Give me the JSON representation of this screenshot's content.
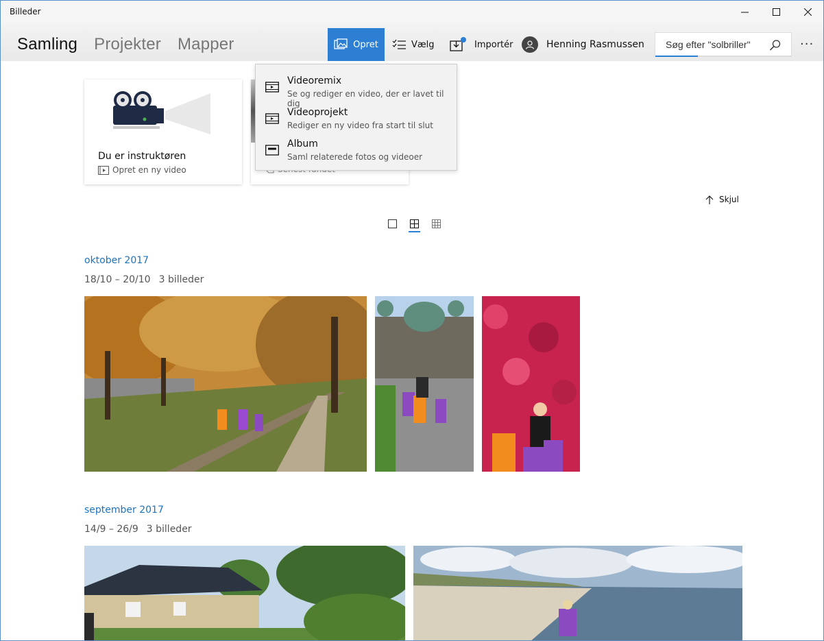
{
  "window": {
    "title": "Billeder"
  },
  "nav": {
    "items": [
      {
        "label": "Samling"
      },
      {
        "label": "Projekter"
      },
      {
        "label": "Mapper"
      }
    ]
  },
  "toolbar": {
    "create_label": "Opret",
    "select_label": "Vælg",
    "import_label": "Importér",
    "user_name": "Henning Rasmussen",
    "search_placeholder": "Søg efter \"solbriller\""
  },
  "cards": [
    {
      "title": "Du er instruktøren",
      "subtitle": "Opret en ny video"
    },
    {
      "subtitle": "Senest fundet"
    }
  ],
  "create_menu": {
    "items": [
      {
        "label": "Videoremix",
        "desc": "Se og rediger en video, der er lavet til dig"
      },
      {
        "label": "Videoprojekt",
        "desc": "Rediger en ny video fra start til slut"
      },
      {
        "label": "Album",
        "desc": "Saml relaterede fotos og videoer"
      }
    ]
  },
  "hide_label": "Skjul",
  "groups": [
    {
      "month": "oktober 2017",
      "range": "18/10 – 20/10",
      "count": "3 billeder"
    },
    {
      "month": "september 2017",
      "range": "14/9 – 26/9",
      "count": "3 billeder"
    }
  ],
  "colors": {
    "accent": "#2d7fd3",
    "link": "#1e73be"
  }
}
